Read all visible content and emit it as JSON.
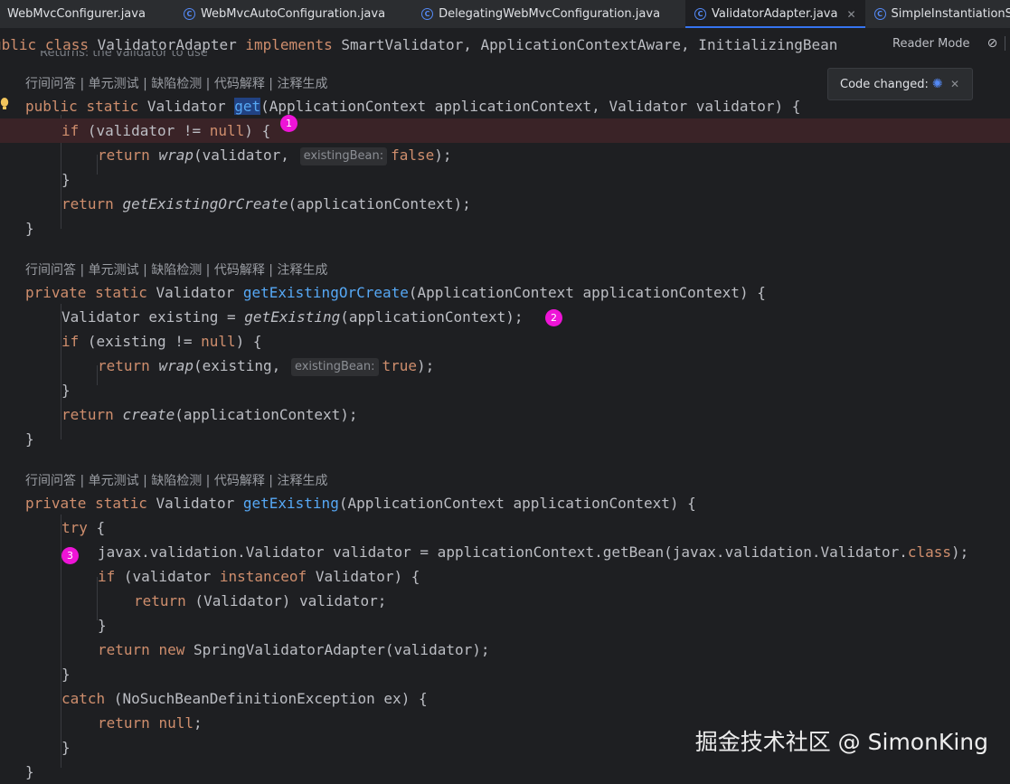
{
  "tabs": [
    {
      "label": "WebMvcConfigurer.java",
      "active": false,
      "icon": "none"
    },
    {
      "label": "WebMvcAutoConfiguration.java",
      "active": false,
      "icon": "class-icon"
    },
    {
      "label": "DelegatingWebMvcConfiguration.java",
      "active": false,
      "icon": "class-icon"
    },
    {
      "label": "ValidatorAdapter.java",
      "active": true,
      "icon": "class-icon"
    },
    {
      "label": "SimpleInstantiationStrategy.java",
      "active": false,
      "icon": "class-icon"
    }
  ],
  "reader_mode": {
    "label": "Reader Mode"
  },
  "popup": {
    "text": "Code changed:"
  },
  "header": {
    "t1": "ublic",
    "t2": "class",
    "t3": "ValidatorAdapter",
    "t4": "implements",
    "t5": "SmartValidator, ApplicationContextAware, InitializingBean"
  },
  "javadoc": "Returns: the validator to use",
  "code_lens": "行间问答 | 单元测试 | 缺陷检测 | 代码解释 | 注释生成",
  "code": {
    "public": "public",
    "private": "private",
    "static": "static",
    "validator_type": "Validator",
    "get": "get",
    "get_params": "(ApplicationContext applicationContext, Validator validator) {",
    "if": "if",
    "return": "return",
    "null": "null",
    "new": "new",
    "try": "try",
    "catch": "catch",
    "instanceof": "instanceof",
    "class": "class",
    "true": "true",
    "false": "false",
    "cond1": " (validator != ",
    "cond1_end": ") {",
    "wrap": "wrap",
    "wrap_args1": "(validator, ",
    "hint": "existingBean:",
    "end_paren_semi": ");",
    "close_brace": "}",
    "getExistingOrCreate": "getExistingOrCreate",
    "app_ctx_call": "(applicationContext);",
    "goc_params": "(ApplicationContext applicationContext) {",
    "validator_existing": "Validator existing = ",
    "getExisting": "getExisting",
    "cond2": " (existing != ",
    "wrap_args2": "(existing, ",
    "create": "create",
    "try_brace": " {",
    "javax_line_a": "javax.validation.Validator validator = applicationContext.getBean(javax.validation.Validator.",
    "javax_line_b": ");",
    "cond3_a": " (validator ",
    "cond3_b": " Validator) {",
    "cast_return": " (Validator) validator;",
    "spring_adapter": " SpringValidatorAdapter(validator);",
    "catch_rest": " (NoSuchBeanDefinitionException ex) {",
    "return_null_semi": ";"
  },
  "badges": [
    "1",
    "2",
    "3"
  ],
  "watermark": "掘金技术社区 @ SimonKing",
  "colors": {
    "keyword": "#cf8e6d",
    "method": "#56a8f5",
    "text": "#bcbec4",
    "badge": "#ee14d7",
    "highlight": "#3a2327"
  }
}
